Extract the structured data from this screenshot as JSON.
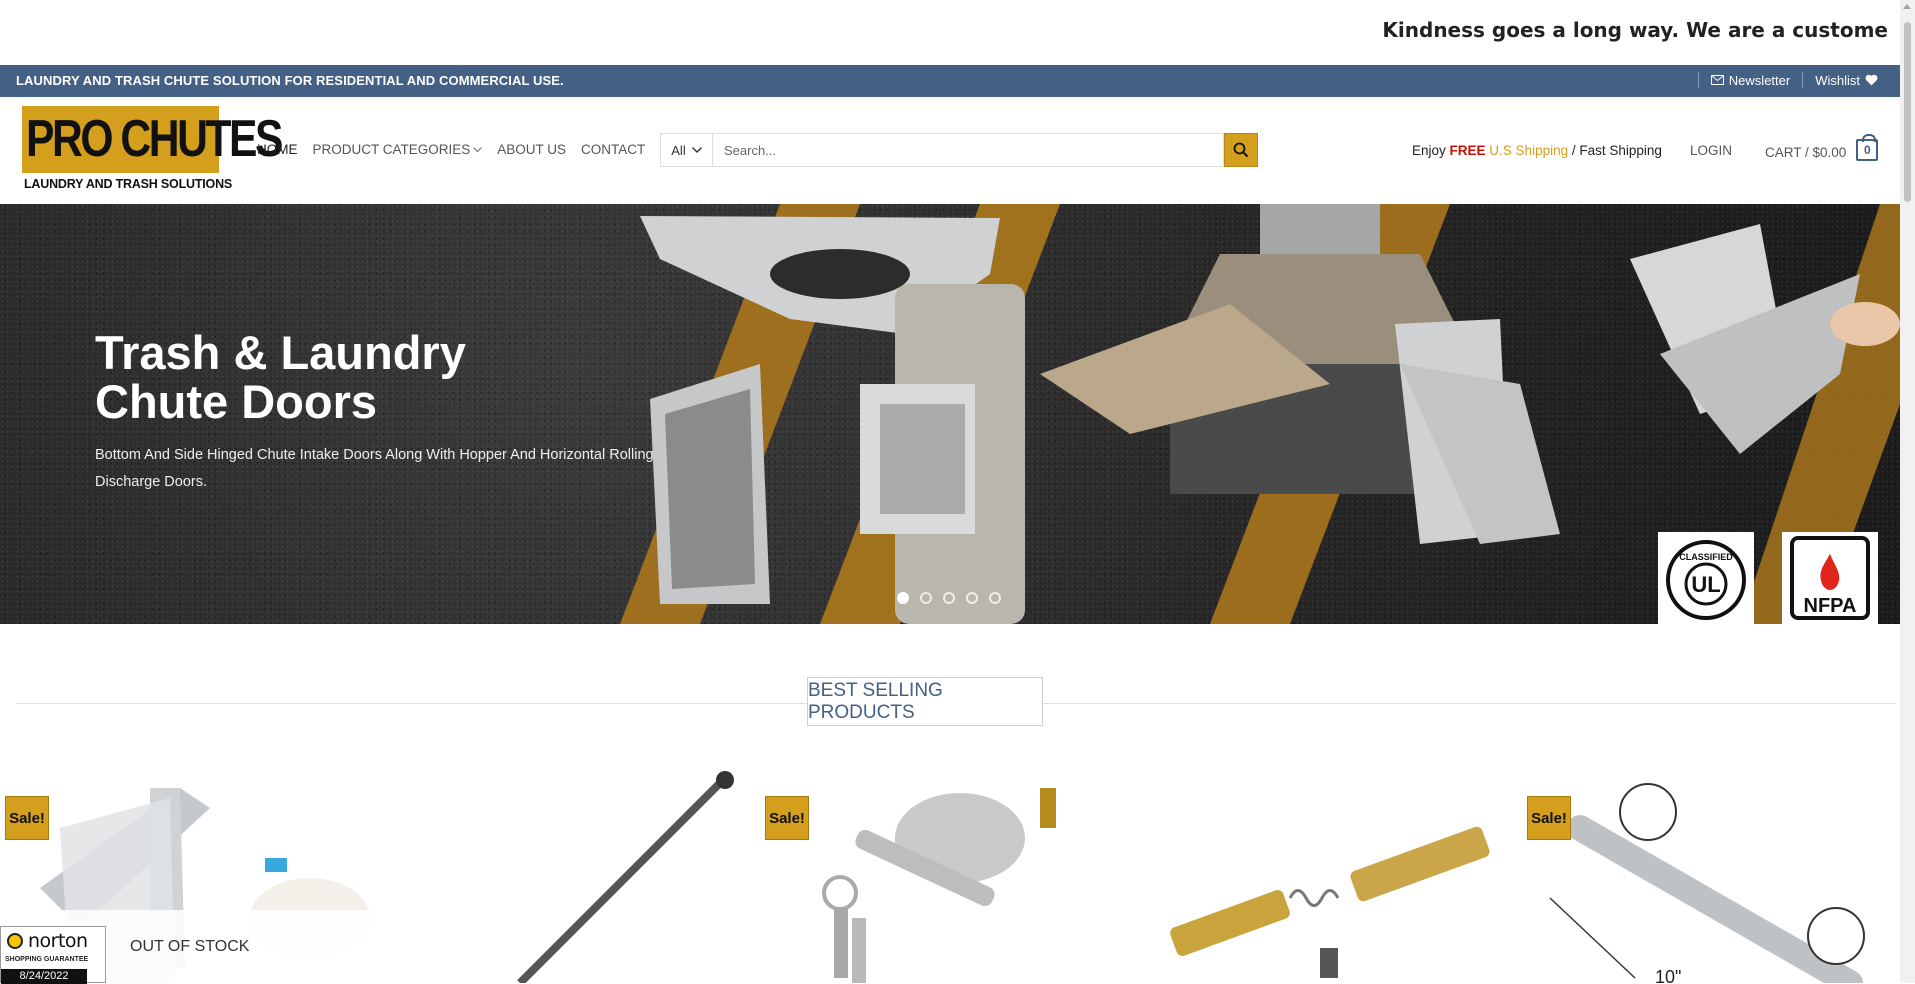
{
  "marquee": {
    "text": "Kindness goes a long way. We are a custome"
  },
  "topbar": {
    "message": "LAUNDRY AND TRASH CHUTE SOLUTION FOR RESIDENTIAL AND COMMERCIAL USE.",
    "newsletter": "Newsletter",
    "wishlist": "Wishlist"
  },
  "header": {
    "logo_text": "PRO CHUTES",
    "logo_tagline": "LAUNDRY AND TRASH SOLUTIONS",
    "nav": [
      "HOME",
      "PRODUCT CATEGORIES",
      "ABOUT US",
      "CONTACT"
    ],
    "search": {
      "category": "All",
      "placeholder": "Search..."
    },
    "shipping": {
      "enjoy": "Enjoy ",
      "free": "FREE",
      "us": " U.S Shipping",
      "fast": " / Fast Shipping"
    },
    "login": "LOGIN",
    "cart_label": "CART / $0.00",
    "cart_count": "0"
  },
  "hero": {
    "title_line1": "Trash & Laundry",
    "title_line2": "Chute Doors",
    "subtitle": "Bottom And Side Hinged Chute Intake Doors Along With Hopper And Horizontal Rolling Discharge Doors.",
    "slide_count": 5,
    "active_slide": 1,
    "badge_ul": "UL",
    "badge_ul_top": "CLASSIFIED",
    "badge_nfpa": "NFPA"
  },
  "section": {
    "title": "BEST SELLING PRODUCTS"
  },
  "products": [
    {
      "sale": "Sale!",
      "status": "OUT OF STOCK"
    },
    {
      "sale": ""
    },
    {
      "sale": "Sale!"
    },
    {
      "sale": ""
    },
    {
      "sale": "Sale!",
      "dimension": "10\""
    }
  ],
  "norton": {
    "name": "norton",
    "guarantee": "SHOPPING GUARANTEE",
    "date": "8/24/2022"
  },
  "colors": {
    "brand_blue": "#446084",
    "brand_gold": "#d49f1c",
    "free_red": "#c41200"
  }
}
